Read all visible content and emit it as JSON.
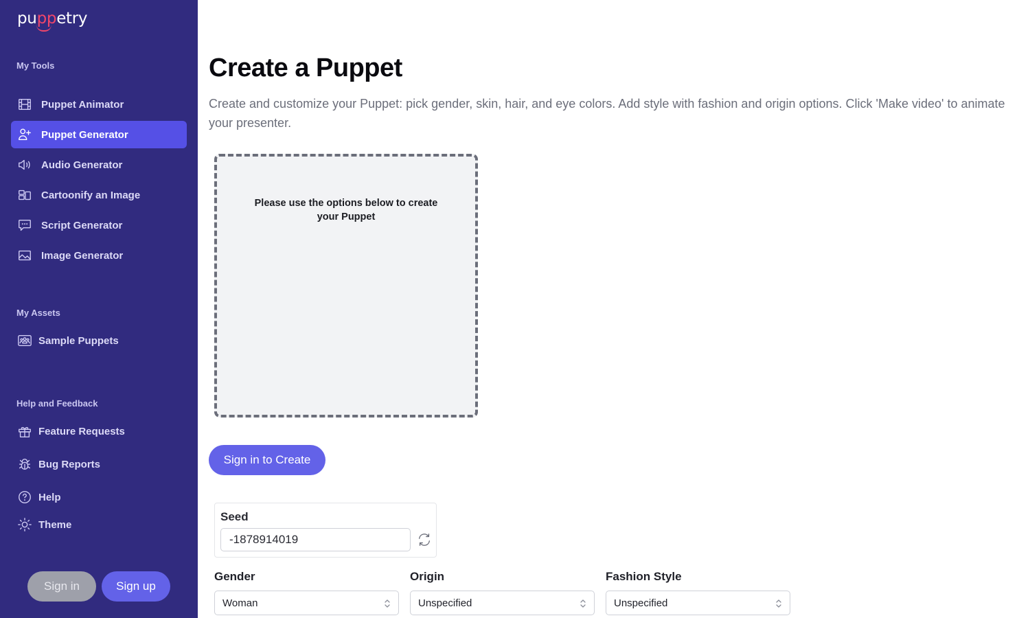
{
  "brand": {
    "logo_prefix": "pu",
    "logo_highlight": "pp",
    "logo_suffix": "etry",
    "accent_color": "#f0466a",
    "sidebar_bg": "#312b7f",
    "primary_color": "#6362e8"
  },
  "sidebar": {
    "sections": [
      {
        "title": "My Tools",
        "items": [
          {
            "label": "Puppet Animator",
            "icon": "film-icon",
            "active": false
          },
          {
            "label": "Puppet Generator",
            "icon": "user-plus-icon",
            "active": true
          },
          {
            "label": "Audio Generator",
            "icon": "speaker-icon",
            "active": false
          },
          {
            "label": "Cartoonify an Image",
            "icon": "layout-icon",
            "active": false
          },
          {
            "label": "Script Generator",
            "icon": "chat-bubble-icon",
            "active": false
          },
          {
            "label": "Image Generator",
            "icon": "image-icon",
            "active": false
          }
        ]
      },
      {
        "title": "My Assets",
        "items": [
          {
            "label": "Sample Puppets",
            "icon": "group-icon",
            "active": false
          }
        ]
      },
      {
        "title": "Help and Feedback",
        "items": [
          {
            "label": "Feature Requests",
            "icon": "gift-icon",
            "active": false
          },
          {
            "label": "Bug Reports",
            "icon": "bug-icon",
            "active": false
          },
          {
            "label": "Help",
            "icon": "question-circle-icon",
            "active": false
          },
          {
            "label": "Theme",
            "icon": "sun-icon",
            "active": false
          }
        ]
      }
    ],
    "signin_label": "Sign in",
    "signup_label": "Sign up"
  },
  "main": {
    "title": "Create a Puppet",
    "description": "Create and customize your Puppet: pick gender, skin, hair, and eye colors. Add style with fashion and origin options. Click 'Make video' to animate your presenter.",
    "preview_message": "Please use the options below to create your Puppet",
    "create_button_label": "Sign in to Create",
    "seed": {
      "label": "Seed",
      "value": "-1878914019"
    },
    "fields": [
      {
        "label": "Gender",
        "value": "Woman"
      },
      {
        "label": "Origin",
        "value": "Unspecified"
      },
      {
        "label": "Fashion Style",
        "value": "Unspecified"
      }
    ]
  }
}
